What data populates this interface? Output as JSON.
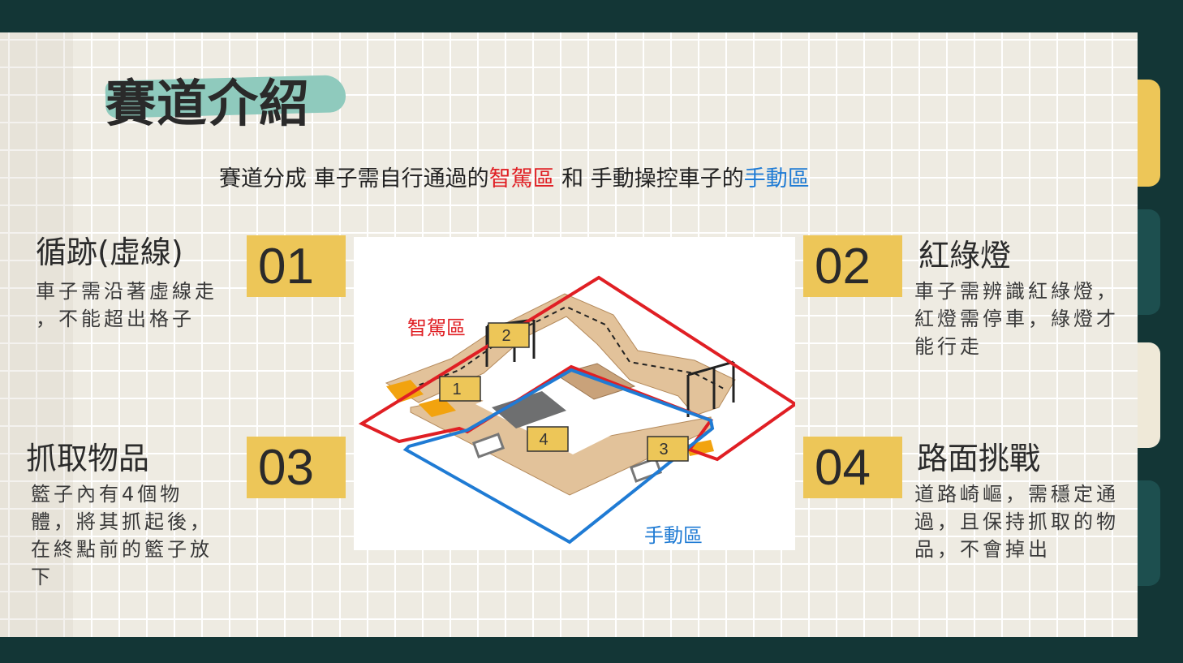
{
  "title": "賽道介紹",
  "subtitle": {
    "part1": "賽道分成 車子需自行通過的",
    "smart_zone": "智駕區",
    "part2": " 和 手動操控車子的",
    "manual_zone": "手動區"
  },
  "items": [
    {
      "number": "01",
      "heading": "循跡(虛線)",
      "description": "車子需沿著虛線走 ，不能超出格子"
    },
    {
      "number": "02",
      "heading": "紅綠燈",
      "description": "車子需辨識紅綠燈，紅燈需停車，綠燈才能行走"
    },
    {
      "number": "03",
      "heading": "抓取物品",
      "description": "籃子內有4個物體，將其抓起後，在終點前的籃子放下"
    },
    {
      "number": "04",
      "heading": "路面挑戰",
      "description": "道路崎嶇，需穩定通過，且保持抓取的物品，不會掉出"
    }
  ],
  "diagram": {
    "smart_label": "智駕區",
    "manual_label": "手動區",
    "markers": [
      "1",
      "2",
      "3",
      "4"
    ]
  },
  "colors": {
    "background": "#133636",
    "number_box": "#edc658",
    "title_highlight": "#8fcabd",
    "smart_zone": "#e01f24",
    "manual_zone": "#1f7bd4"
  }
}
